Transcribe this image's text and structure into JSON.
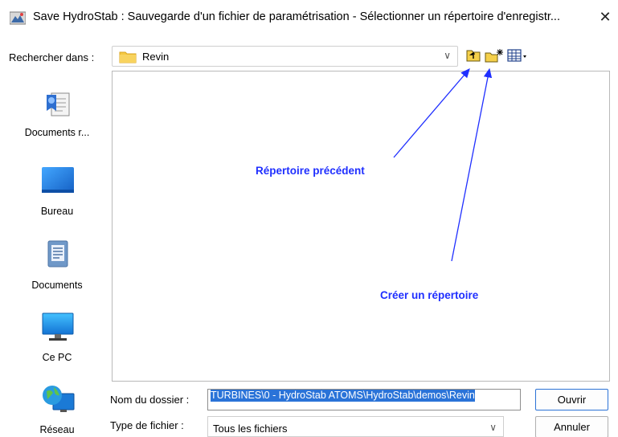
{
  "window": {
    "title": "Save HydroStab : Sauvegarde d'un fichier de paramétrisation - Sélectionner un répertoire d'enregistr...",
    "close_glyph": "✕"
  },
  "look_in": {
    "label": "Rechercher dans :",
    "value": "Revin",
    "icon": "folder-icon"
  },
  "toolbar": {
    "buttons": [
      {
        "icon": "up-folder-icon",
        "tooltip": "Répertoire précédent"
      },
      {
        "icon": "new-folder-icon",
        "tooltip": "Créer un répertoire"
      },
      {
        "icon": "view-menu-icon"
      }
    ]
  },
  "places": [
    {
      "label": "Documents r...",
      "icon": "recent-documents-icon"
    },
    {
      "label": "Bureau",
      "icon": "desktop-icon"
    },
    {
      "label": "Documents",
      "icon": "documents-icon"
    },
    {
      "label": "Ce PC",
      "icon": "computer-icon"
    },
    {
      "label": "Réseau",
      "icon": "network-icon"
    }
  ],
  "annotations": {
    "previous_dir": "Répertoire précédent",
    "create_dir": "Créer un répertoire"
  },
  "form": {
    "folder_name_label": "Nom du dossier :",
    "folder_name_value": "TURBINES\\0 - HydroStab ATOMS\\HydroStab\\demos\\Revin",
    "file_type_label": "Type de fichier :",
    "file_type_value": "Tous les fichiers"
  },
  "buttons": {
    "open": "Ouvrir",
    "cancel": "Annuler"
  },
  "colors": {
    "annotation": "#1f2fff",
    "selection": "#2a73d8",
    "folder": "#f5c842"
  }
}
